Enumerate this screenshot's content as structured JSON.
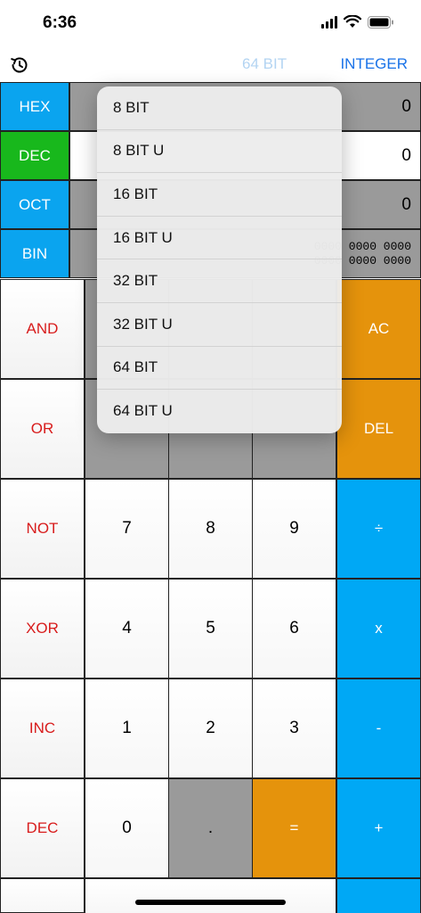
{
  "status_bar": {
    "time": "6:36"
  },
  "toolbar": {
    "history_icon": "history-clock-icon",
    "bit_mode": "64 BIT",
    "number_mode": "INTEGER"
  },
  "bases": [
    {
      "label": "HEX",
      "value": "0",
      "label_color": "#0aa4ef"
    },
    {
      "label": "DEC",
      "value": "0",
      "label_color": "#18b81c"
    },
    {
      "label": "OCT",
      "value": "0",
      "label_color": "#0aa4ef"
    },
    {
      "label": "BIN",
      "value_line1": "0000 0000 0000",
      "value_line2": "0000 0000 0000",
      "label_color": "#0aa4ef"
    }
  ],
  "dropdown": {
    "items": [
      "8 BIT",
      "8 BIT U",
      "16 BIT",
      "16 BIT U",
      "32 BIT",
      "32 BIT U",
      "64 BIT",
      "64 BIT U"
    ]
  },
  "keys": {
    "and": "AND",
    "or": "OR",
    "not": "NOT",
    "xor": "XOR",
    "inc": "INC",
    "dec": "DEC",
    "ac": "AC",
    "del": "DEL",
    "seven": "7",
    "eight": "8",
    "nine": "9",
    "divide": "÷",
    "four": "4",
    "five": "5",
    "six": "6",
    "multiply": "x",
    "one": "1",
    "two": "2",
    "three": "3",
    "minus": "-",
    "zero": "0",
    "dot": ".",
    "equals": "=",
    "plus": "+"
  }
}
